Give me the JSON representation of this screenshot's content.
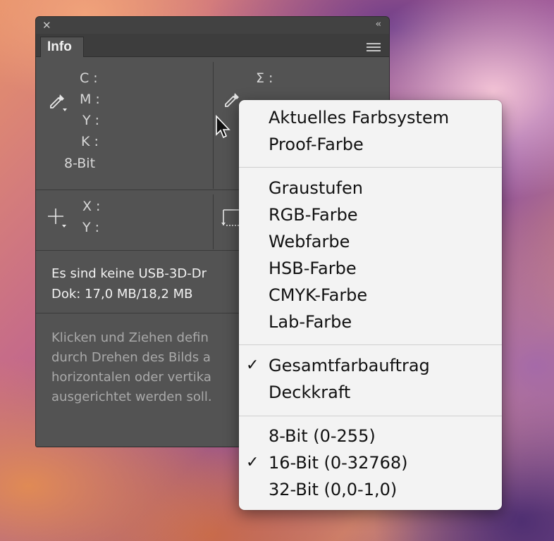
{
  "panel": {
    "tab_label": "Info",
    "color_labels_left": [
      "C :",
      "M :",
      "Y :",
      "K :"
    ],
    "bit_label": "8-Bit",
    "color_label_right": "Σ :",
    "xy_labels": [
      "X :",
      "Y :"
    ],
    "status_line1": "Es sind keine USB-3D-Dr",
    "status_line2": "Dok: 17,0 MB/18,2 MB",
    "help_lines": [
      "Klicken und Ziehen defin",
      "durch Drehen des Bilds a",
      "horizontalen oder vertika",
      "ausgerichtet werden soll."
    ]
  },
  "menu": {
    "items": [
      {
        "label": "Aktuelles Farbsystem",
        "checked": false
      },
      {
        "label": "Proof-Farbe",
        "checked": false
      },
      {
        "label": "Graustufen",
        "checked": false
      },
      {
        "label": "RGB-Farbe",
        "checked": false
      },
      {
        "label": "Webfarbe",
        "checked": false
      },
      {
        "label": "HSB-Farbe",
        "checked": false
      },
      {
        "label": "CMYK-Farbe",
        "checked": false
      },
      {
        "label": "Lab-Farbe",
        "checked": false
      },
      {
        "label": "Gesamtfarbauftrag",
        "checked": true
      },
      {
        "label": "Deckkraft",
        "checked": false
      },
      {
        "label": "8-Bit (0-255)",
        "checked": false
      },
      {
        "label": "16-Bit (0-32768)",
        "checked": true
      },
      {
        "label": "32-Bit (0,0-1,0)",
        "checked": false
      }
    ],
    "check_glyph": "✓"
  },
  "icons": {
    "close": "close-icon",
    "collapse": "collapse-icon",
    "panel_menu": "panel-menu-icon",
    "eyedropper": "eyedropper-icon",
    "crosshair": "crosshair-icon",
    "selection_size": "selection-size-icon",
    "cursor": "mouse-pointer-icon"
  }
}
